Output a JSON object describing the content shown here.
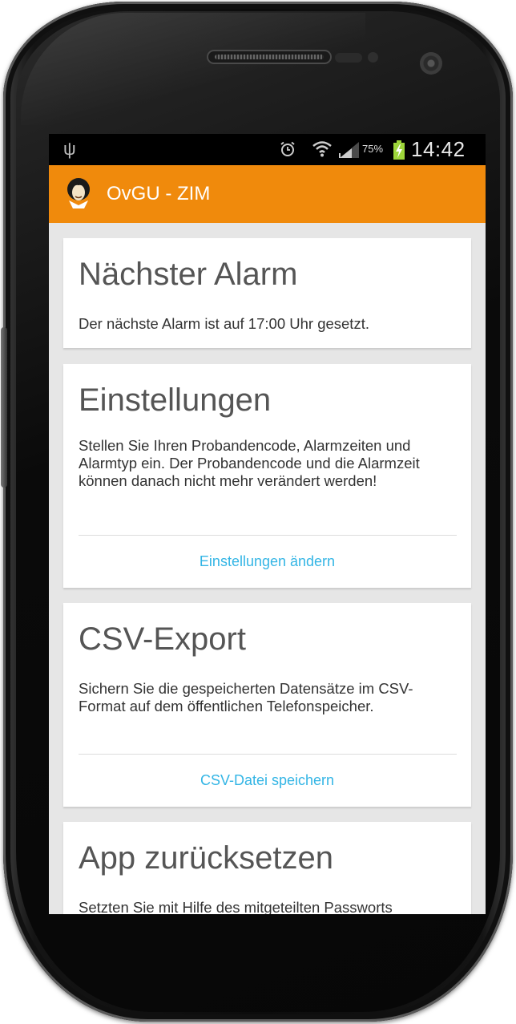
{
  "status_bar": {
    "battery_percent": "75%",
    "time": "14:42",
    "icons": [
      "usb-icon",
      "alarm-icon",
      "wifi-icon",
      "signal-icon",
      "battery-charging-icon"
    ]
  },
  "action_bar": {
    "title": "OvGU - ZIM",
    "logo_icon": "app-logo-icon",
    "color": "#f08a0c"
  },
  "cards": {
    "next_alarm": {
      "title": "Nächster Alarm",
      "text": "Der nächste Alarm ist auf 17:00 Uhr gesetzt."
    },
    "settings": {
      "title": "Einstellungen",
      "text": "Stellen Sie Ihren Probandencode, Alarmzeiten und Alarmtyp ein. Der Probandencode und die Alarmzeit können danach nicht mehr verändert werden!",
      "action_label": "Einstellungen ändern"
    },
    "csv_export": {
      "title": "CSV-Export",
      "text": "Sichern Sie die gespeicherten Datensätze im CSV-Format auf dem öffentlichen Telefonspeicher.",
      "action_label": "CSV-Datei speichern"
    },
    "reset": {
      "title": "App zurücksetzen",
      "text": "Setzten Sie mit Hilfe des mitgeteilten Passworts"
    }
  },
  "colors": {
    "accent": "#33b5e5",
    "action_bar": "#f08a0c",
    "background": "#e6e6e6"
  }
}
